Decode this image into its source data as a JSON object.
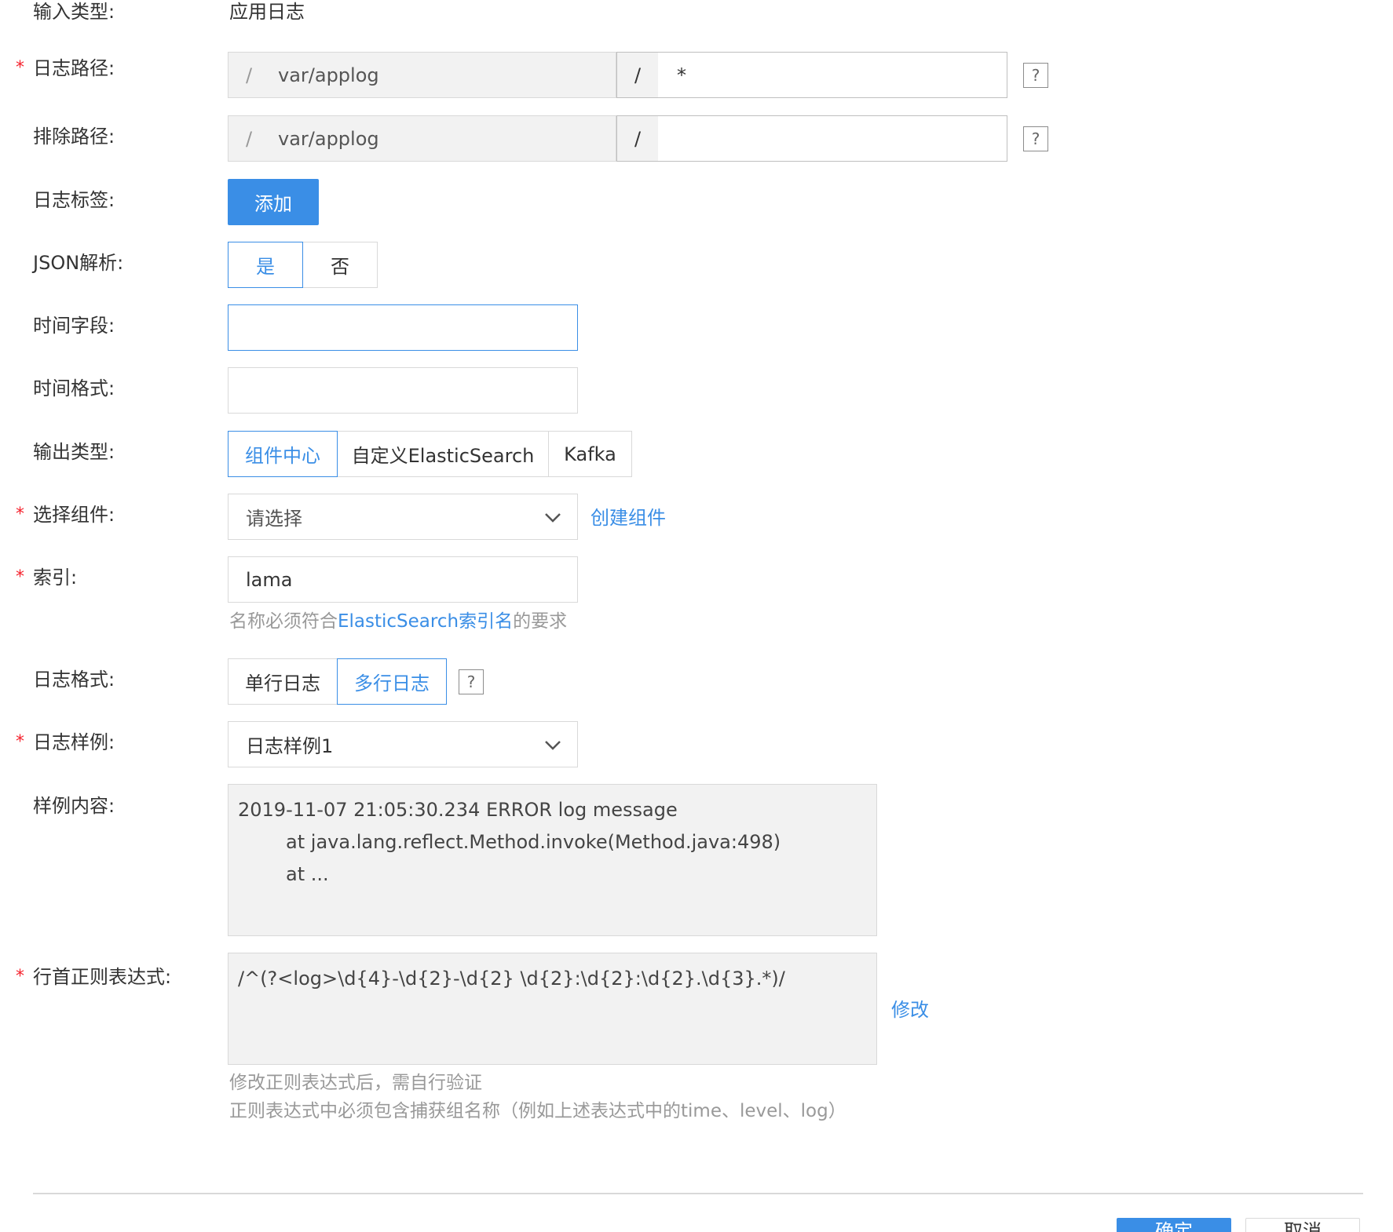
{
  "form": {
    "input_type": {
      "label": "输入类型:",
      "value": "应用日志"
    },
    "log_path": {
      "label": "日志路径:",
      "prefix": "/",
      "base": "var/applog",
      "slash": "/",
      "value": "*",
      "help": "?"
    },
    "exclude_path": {
      "label": "排除路径:",
      "prefix": "/",
      "base": "var/applog",
      "slash": "/",
      "value": "",
      "help": "?"
    },
    "log_tags": {
      "label": "日志标签:",
      "add_button": "添加"
    },
    "json_parse": {
      "label": "JSON解析:",
      "options": [
        "是",
        "否"
      ],
      "selected": "是"
    },
    "time_field": {
      "label": "时间字段:",
      "value": ""
    },
    "time_format": {
      "label": "时间格式:",
      "value": ""
    },
    "output_type": {
      "label": "输出类型:",
      "options": [
        "组件中心",
        "自定义ElasticSearch",
        "Kafka"
      ],
      "selected": "组件中心"
    },
    "component": {
      "label": "选择组件:",
      "placeholder": "请选择",
      "create_link": "创建组件"
    },
    "index": {
      "label": "索引:",
      "value": "lama",
      "hint_prefix": "名称必须符合",
      "hint_link": "ElasticSearch索引名",
      "hint_suffix": "的要求"
    },
    "log_format": {
      "label": "日志格式:",
      "options": [
        "单行日志",
        "多行日志"
      ],
      "selected": "多行日志",
      "help": "?"
    },
    "log_sample": {
      "label": "日志样例:",
      "value": "日志样例1"
    },
    "sample_content": {
      "label": "样例内容:",
      "lines": [
        "2019-11-07 21:05:30.234 ERROR log message",
        "        at java.lang.reflect.Method.invoke(Method.java:498)",
        "        at ..."
      ]
    },
    "line_regex": {
      "label": "行首正则表达式:",
      "value": "/^(?<log>\\d{4}-\\d{2}-\\d{2} \\d{2}:\\d{2}:\\d{2}.\\d{3}.*)/",
      "edit_link": "修改",
      "hint_1": "修改正则表达式后，需自行验证",
      "hint_2": "正则表达式中必须包含捕获组名称（例如上述表达式中的time、level、log）"
    }
  },
  "required_mark": "*",
  "footer": {
    "confirm": "确定",
    "cancel": "取消"
  },
  "colors": {
    "accent": "#3a8ee6",
    "required": "#f5222d",
    "hint": "#999999"
  }
}
